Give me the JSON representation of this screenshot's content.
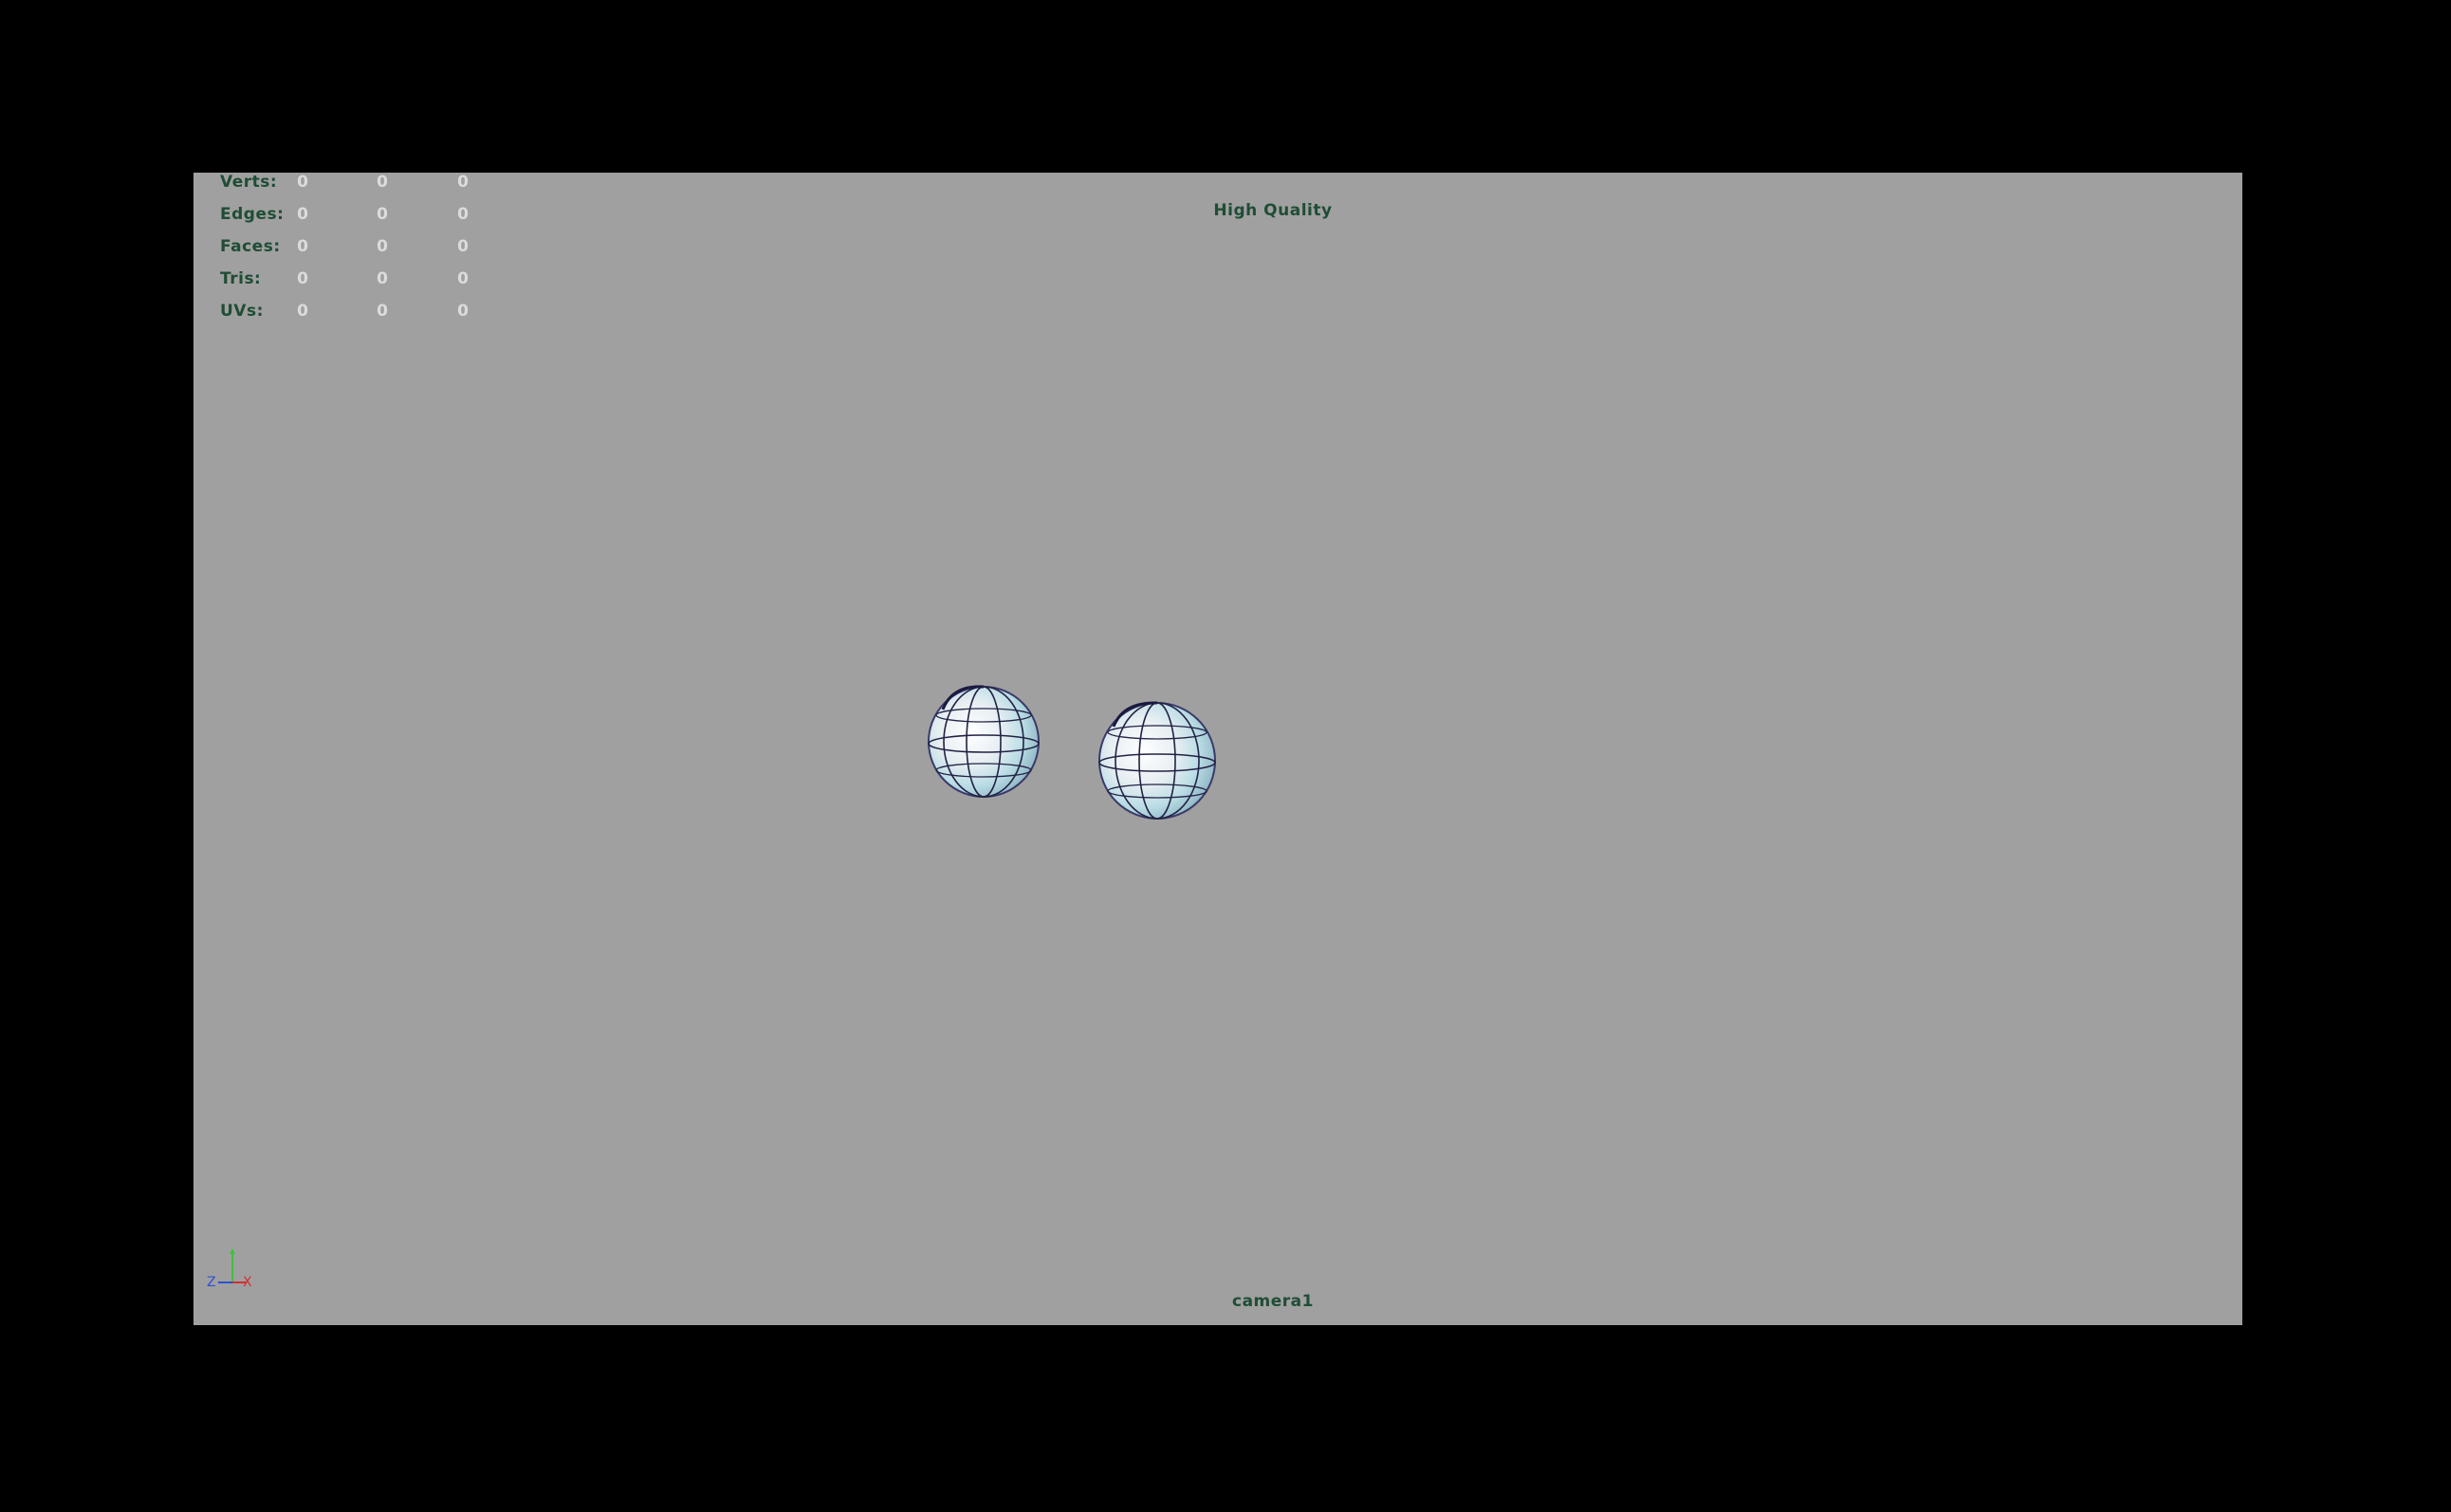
{
  "hud": {
    "rows": [
      {
        "label": "Verts:",
        "values": [
          "0",
          "0",
          "0"
        ]
      },
      {
        "label": "Edges:",
        "values": [
          "0",
          "0",
          "0"
        ]
      },
      {
        "label": "Faces:",
        "values": [
          "0",
          "0",
          "0"
        ]
      },
      {
        "label": "Tris:",
        "values": [
          "0",
          "0",
          "0"
        ]
      },
      {
        "label": "UVs:",
        "values": [
          "0",
          "0",
          "0"
        ]
      }
    ]
  },
  "viewport": {
    "quality_label": "High Quality",
    "camera_label": "camera1",
    "background_color": "#a0a0a0"
  },
  "axis": {
    "z_label": "Z",
    "x_label": "X",
    "y_color": "#3fbf3f",
    "x_color": "#d03030",
    "z_color": "#3050d0"
  },
  "scene": {
    "objects": [
      "sphere-1",
      "sphere-2"
    ]
  }
}
